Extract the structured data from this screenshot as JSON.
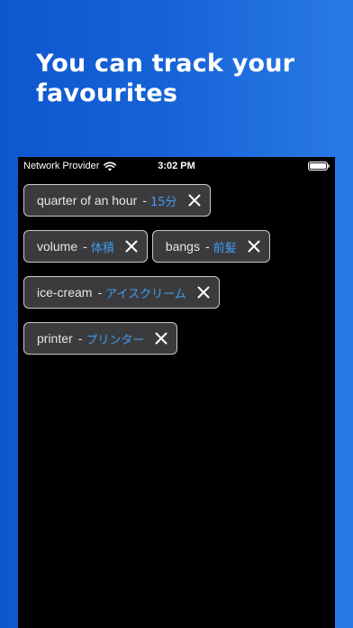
{
  "promo": {
    "headline": "You can track your favourites"
  },
  "status_bar": {
    "carrier": "Network Provider",
    "time": "3:02 PM",
    "wifi_icon": "wifi-icon",
    "battery_icon": "battery-icon"
  },
  "favourites": [
    [
      {
        "term": "quarter of an hour",
        "separator": "-",
        "translation": "15分"
      }
    ],
    [
      {
        "term": "volume",
        "separator": "-",
        "translation": "体積"
      },
      {
        "term": "bangs",
        "separator": "-",
        "translation": "前髪"
      }
    ],
    [
      {
        "term": "ice-cream",
        "separator": "-",
        "translation": "アイスクリーム"
      }
    ],
    [
      {
        "term": "printer",
        "separator": "-",
        "translation": "プリンター"
      }
    ]
  ],
  "colors": {
    "background_gradient_start": "#0f57cf",
    "background_gradient_end": "#2a7ae6",
    "chip_background": "#3b3b3d",
    "chip_border": "#c9c9c9",
    "translation_text": "#3f9cf0"
  },
  "icons": {
    "remove": "close-icon"
  }
}
